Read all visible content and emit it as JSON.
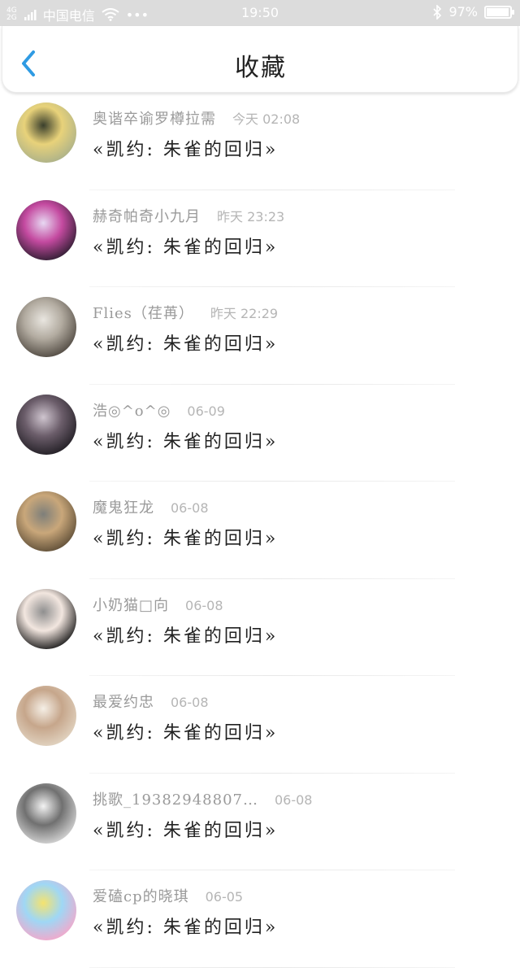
{
  "status_bar": {
    "signal_top": "4G",
    "signal_bottom": "2G",
    "carrier": "中国电信",
    "dots": "•••",
    "time": "19:50",
    "battery": "97%",
    "battery_level": 0.97
  },
  "header": {
    "title": "收藏"
  },
  "favorites": [
    {
      "name": "奥谐卒谕罗樽拉需",
      "time": "今天 02:08",
      "book": "«凯约: 朱雀的回归»",
      "avatar_colors": [
        "#a9b08a",
        "#e8d27a",
        "#3a3f2c"
      ]
    },
    {
      "name": "赫奇帕奇小九月",
      "time": "昨天 23:23",
      "book": "«凯约: 朱雀的回归»",
      "avatar_colors": [
        "#2a1c2e",
        "#c44aa0",
        "#e7d8f2"
      ]
    },
    {
      "name": "Flies（荏苒）",
      "time": "昨天 22:29",
      "book": "«凯约: 朱雀的回归»",
      "avatar_colors": [
        "#4d463e",
        "#b2aba0",
        "#e9e6e0"
      ]
    },
    {
      "name": "浩◎^o^◎",
      "time": "06-09",
      "book": "«凯约: 朱雀的回归»",
      "avatar_colors": [
        "#1f1c22",
        "#6b5d6a",
        "#cfc5cf"
      ]
    },
    {
      "name": "魔鬼狂龙",
      "time": "06-08",
      "book": "«凯约: 朱雀的回归»",
      "avatar_colors": [
        "#5b4b35",
        "#c9a77a",
        "#7e7f7a"
      ]
    },
    {
      "name": "小奶猫□向",
      "time": "06-08",
      "book": "«凯约: 朱雀的回归»",
      "avatar_colors": [
        "#151515",
        "#f2e6df",
        "#8f8f8f"
      ]
    },
    {
      "name": "最爱约忠",
      "time": "06-08",
      "book": "«凯约: 朱雀的回归»",
      "avatar_colors": [
        "#e3d6c4",
        "#c6a68b",
        "#f5efe6"
      ]
    },
    {
      "name": "挑歌_19382948807…",
      "time": "06-08",
      "book": "«凯约: 朱雀的回归»",
      "avatar_colors": [
        "#d9d9d9",
        "#707070",
        "#f3f3f3"
      ]
    },
    {
      "name": "爱磕cp的晓琪",
      "time": "06-05",
      "book": "«凯约: 朱雀的回归»",
      "avatar_colors": [
        "#f7a6c9",
        "#9fd7f5",
        "#f5e36e"
      ]
    }
  ],
  "colors": {
    "accent": "#2f9be3",
    "status_bar_bg": "#dcdcdc",
    "name_text": "#9a9a9a",
    "time_text": "#b5b5b5",
    "book_text": "#222222"
  }
}
